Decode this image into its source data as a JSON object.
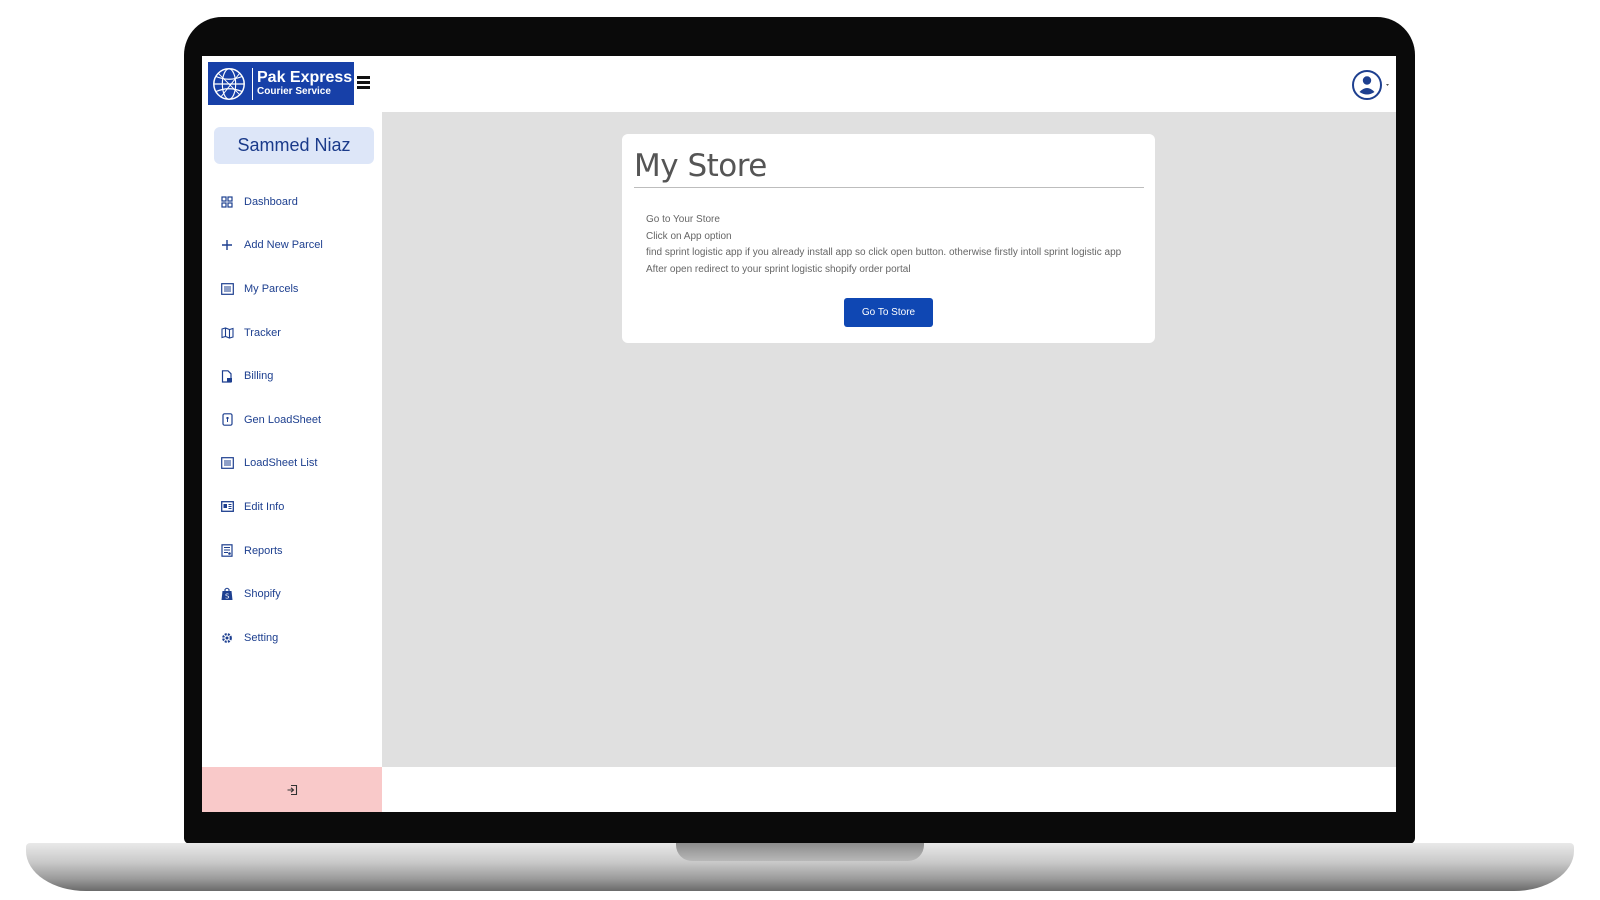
{
  "brand": {
    "title": "Pak Express",
    "subtitle": "Courier Service",
    "color": "#1740a8"
  },
  "header": {
    "menu_icon": "hamburger-icon",
    "user_icon": "user-circle-icon"
  },
  "sidebar": {
    "username": "Sammed Niaz",
    "items": [
      {
        "label": "Dashboard",
        "icon": "grid-icon"
      },
      {
        "label": "Add New Parcel",
        "icon": "plus-icon"
      },
      {
        "label": "My Parcels",
        "icon": "list-icon"
      },
      {
        "label": "Tracker",
        "icon": "map-icon"
      },
      {
        "label": "Billing",
        "icon": "pdf-file-icon"
      },
      {
        "label": "Gen LoadSheet",
        "icon": "document-icon"
      },
      {
        "label": "LoadSheet List",
        "icon": "list-icon"
      },
      {
        "label": "Edit Info",
        "icon": "id-card-icon"
      },
      {
        "label": "Reports",
        "icon": "report-icon"
      },
      {
        "label": "Shopify",
        "icon": "shopify-bag-icon"
      },
      {
        "label": "Setting",
        "icon": "gear-icon"
      }
    ],
    "logout_icon": "logout-icon",
    "logout_color": "#f9c9c9"
  },
  "main": {
    "card": {
      "title": "My Store",
      "steps": [
        "Go to Your Store",
        "Click on App option",
        "find sprint logistic app if you already install app so click open button. otherwise firstly intoll sprint logistic app",
        "After open redirect to your sprint logistic shopify order portal"
      ],
      "button_label": "Go To Store",
      "button_color": "#0f47b3"
    }
  }
}
